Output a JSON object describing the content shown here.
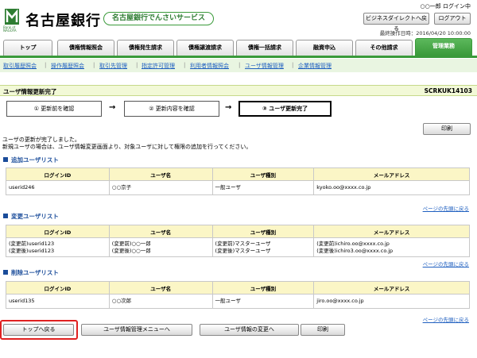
{
  "header": {
    "bank_name": "名古屋銀行",
    "logo_sub": "Bank of NAGOYA",
    "service_name": "名古屋銀行でんさいサービス",
    "login_user": "○○一郎 ログイン中",
    "direct_button": "ビジネスダイレクトへ戻る",
    "logout_button": "ログアウト",
    "last_operation": "最終操作日時：2016/04/20 10:00:00"
  },
  "tabs": [
    "トップ",
    "債権情報照会",
    "債権発生請求",
    "債権譲渡請求",
    "債権一括請求",
    "融資申込",
    "その他請求",
    "管理業務"
  ],
  "subnav": [
    "取引履歴照会",
    "操作履歴照会",
    "取引先管理",
    "指定許可管理",
    "利用者情報照会",
    "ユーザ情報管理",
    "企業情報管理"
  ],
  "page": {
    "title": "ユーザ情報更新完了",
    "screen_id": "SCRKUK14103",
    "steps": [
      "① 更新前を確認",
      "② 更新内容を確認",
      "③ ユーザ更新完了"
    ],
    "arrow": "→",
    "print_button": "印刷",
    "message_line1": "ユーザの更新が完了しました。",
    "message_line2": "新規ユーザの場合は、ユーザ情報変更画面より、対象ユーザに対して権限の追加を行ってください。"
  },
  "columns": [
    "ログインID",
    "ユーザ名",
    "ユーザ種別",
    "メールアドレス"
  ],
  "added": {
    "title": "追加ユーザリスト",
    "rows": [
      [
        "userid246",
        "○○京子",
        "一般ユーザ",
        "kyoko.oo@xxxx.co.jp"
      ]
    ]
  },
  "changed": {
    "title": "変更ユーザリスト",
    "rows": [
      [
        "(変更前)userid123\n(変更後)userid123",
        "(変更前)○○一郎\n(変更後)○○一郎",
        "(変更前)マスターユーザ\n(変更後)マスターユーザ",
        "(変更前)ichiro.oo@xxxx.co.jp\n(変更後)ichiro3.oo@xxxx.co.jp"
      ]
    ]
  },
  "deleted": {
    "title": "削除ユーザリスト",
    "rows": [
      [
        "userid135",
        "○○次郎",
        "一般ユーザ",
        "jiro.oo@xxxx.co.jp"
      ]
    ]
  },
  "page_top_link": "ページの先頭に戻る",
  "footer_buttons": [
    "トップへ戻る",
    "ユーザ情報管理メニューへ",
    "ユーザ情報の変更へ",
    "印刷"
  ],
  "colors": {
    "accent_green": "#3a9a3a",
    "section_blue": "#1a4c9a",
    "highlight_red": "#e02020"
  }
}
